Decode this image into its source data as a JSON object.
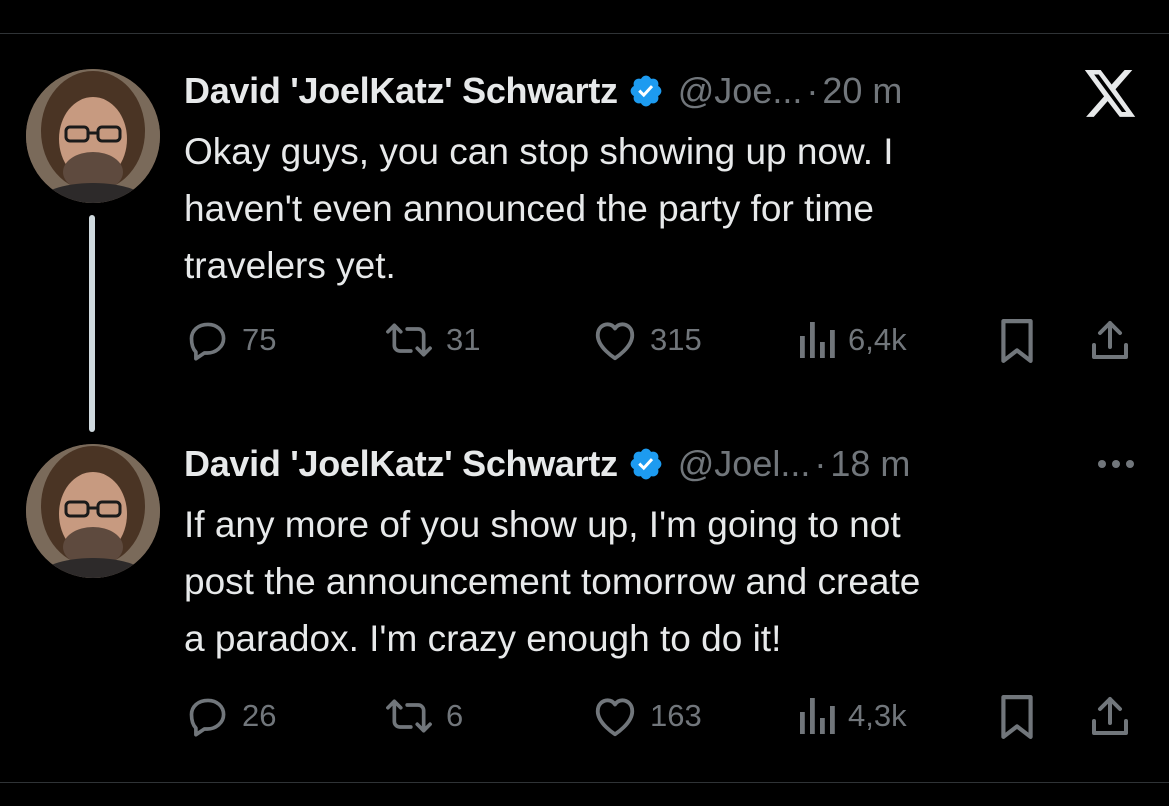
{
  "thread": {
    "tweets": [
      {
        "author_name": "David 'JoelKatz' Schwartz",
        "handle": "@Joe...",
        "separator": "·",
        "time": "20 m",
        "corner_icon": "x-logo-icon",
        "text": "Okay guys, you can stop showing up now. I\nhaven't even announced the party for time\ntravelers yet.",
        "replies": "75",
        "reposts": "31",
        "likes": "315",
        "views": "6,4k"
      },
      {
        "author_name": "David 'JoelKatz' Schwartz",
        "handle": "@Joel...",
        "separator": "·",
        "time": "18 m",
        "corner_icon": "more-icon",
        "text": "If any more of you show up, I'm going to not\npost the announcement tomorrow and create\na paradox. I'm crazy enough to do it!",
        "replies": "26",
        "reposts": "6",
        "likes": "163",
        "views": "4,3k"
      }
    ]
  },
  "colors": {
    "background": "#000000",
    "text_primary": "#e7e9ea",
    "text_secondary": "#71767b",
    "verified_badge": "#1d9bf0",
    "thread_line": "#cfd9de"
  }
}
